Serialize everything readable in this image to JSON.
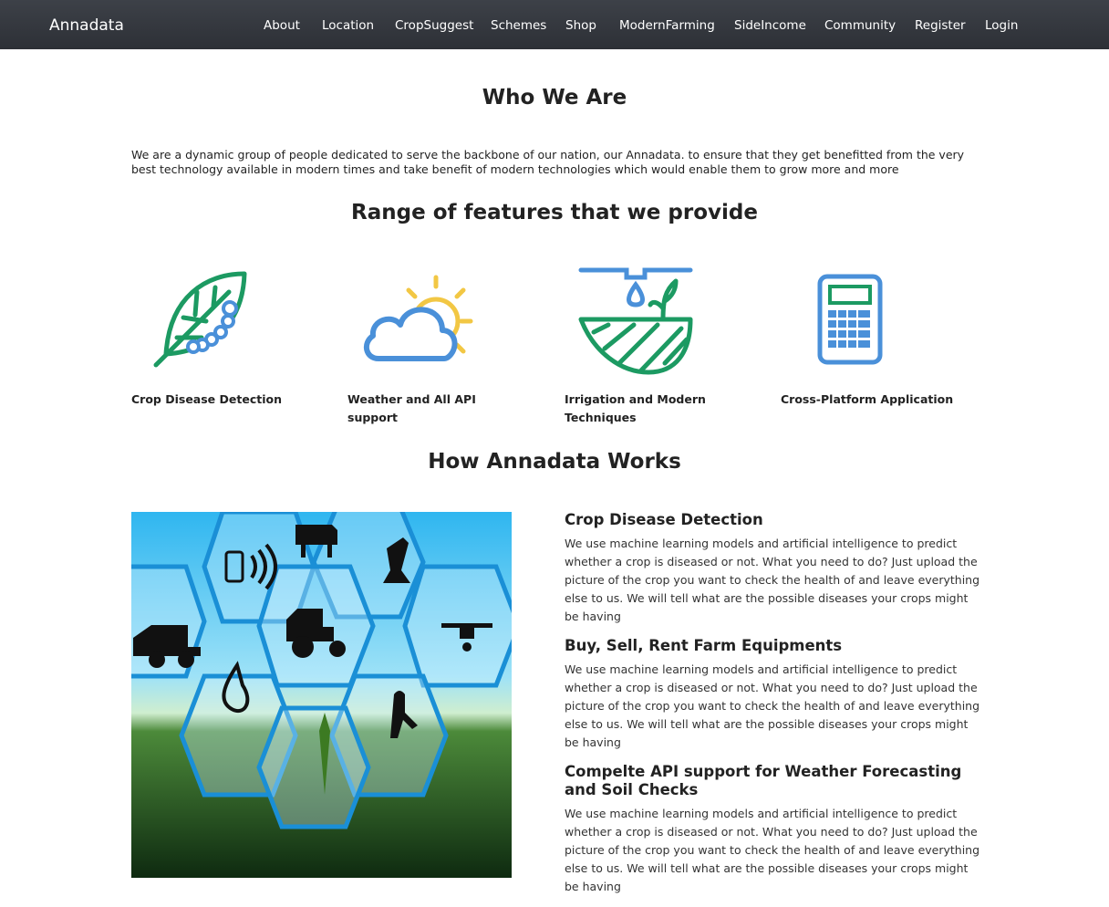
{
  "navbar": {
    "brand": "Annadata",
    "links": [
      "About",
      "Location",
      "CropSuggest",
      "Schemes",
      "Shop",
      "ModernFarming",
      "SideIncome",
      "Community",
      "Register",
      "Login"
    ]
  },
  "who": {
    "title": "Who We Are",
    "text": "We are a dynamic group of people dedicated to serve the backbone of our nation, our Annadata. to ensure that they get benefitted from the very best technology available in modern times and take benefit of modern technologies which would enable them to grow more and more"
  },
  "features": {
    "title": "Range of features that we provide",
    "items": [
      {
        "label": "Crop Disease Detection",
        "icon": "leaf-caterpillar-icon"
      },
      {
        "label": "Weather and All API support",
        "icon": "sun-cloud-icon"
      },
      {
        "label": "Irrigation and Modern Techniques",
        "icon": "irrigation-icon"
      },
      {
        "label": "Cross-Platform Application",
        "icon": "calculator-icon"
      }
    ]
  },
  "works": {
    "title": "How Annadata Works",
    "items": [
      {
        "heading": "Crop Disease Detection",
        "text": "We use machine learning models and artificial intelligence to predict whether a crop is diseased or not. What you need to do? Just upload the picture of the crop you want to check the health of and leave everything else to us. We will tell what are the possible diseases your crops might be having"
      },
      {
        "heading": "Buy, Sell, Rent Farm Equipments",
        "text": "We use machine learning models and artificial intelligence to predict whether a crop is diseased or not. What you need to do? Just upload the picture of the crop you want to check the health of and leave everything else to us. We will tell what are the possible diseases your crops might be having"
      },
      {
        "heading": "Compelte API support for Weather Forecasting and Soil Checks",
        "text": "We use machine learning models and artificial intelligence to predict whether a crop is diseased or not. What you need to do? Just upload the picture of the crop you want to check the health of and leave everything else to us. We will tell what are the possible diseases your crops might be having"
      }
    ]
  },
  "colors": {
    "navbar": "#33363c",
    "leaf_green": "#1c9a62",
    "accent_blue": "#4a90d9",
    "sun_yellow": "#f2c744"
  }
}
